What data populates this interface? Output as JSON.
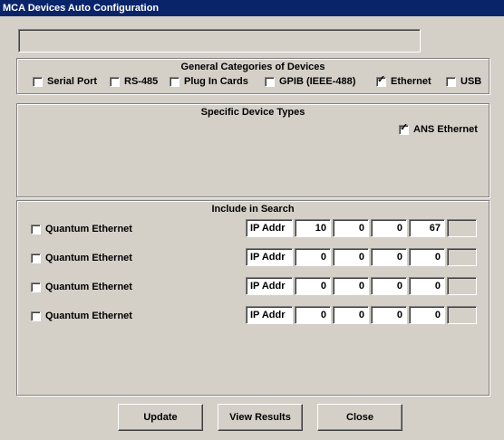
{
  "window": {
    "title": "MCA Devices Auto Configuration"
  },
  "status_field": {
    "value": ""
  },
  "general": {
    "title": "General Categories of Devices",
    "items": [
      {
        "label": "Serial Port",
        "checked": false
      },
      {
        "label": "RS-485",
        "checked": false
      },
      {
        "label": "Plug In Cards",
        "checked": false
      },
      {
        "label": "GPIB (IEEE-488)",
        "checked": false
      },
      {
        "label": "Ethernet",
        "checked": true
      },
      {
        "label": "USB",
        "checked": false
      }
    ]
  },
  "specific": {
    "title": "Specific Device Types",
    "items": [
      {
        "label": "ANS Ethernet",
        "checked": true
      }
    ]
  },
  "search": {
    "title": "Include in Search",
    "rows": [
      {
        "label": "Quantum Ethernet",
        "checked": false,
        "ip_label": "IP Addr",
        "octets": [
          "10",
          "0",
          "0",
          "67"
        ]
      },
      {
        "label": "Quantum Ethernet",
        "checked": false,
        "ip_label": "IP Addr",
        "octets": [
          "0",
          "0",
          "0",
          "0"
        ]
      },
      {
        "label": "Quantum Ethernet",
        "checked": false,
        "ip_label": "IP Addr",
        "octets": [
          "0",
          "0",
          "0",
          "0"
        ]
      },
      {
        "label": "Quantum Ethernet",
        "checked": false,
        "ip_label": "IP Addr",
        "octets": [
          "0",
          "0",
          "0",
          "0"
        ]
      }
    ]
  },
  "buttons": {
    "update": "Update",
    "view_results": "View Results",
    "close": "Close"
  },
  "check_glyph": "✓"
}
